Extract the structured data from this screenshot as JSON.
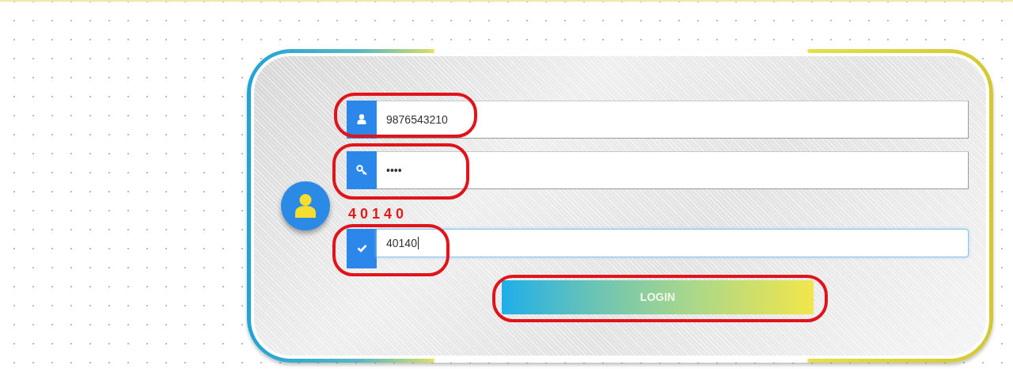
{
  "form": [
    {
      "kind": "username",
      "value": "9876543210",
      "focused": false
    },
    {
      "kind": "password",
      "value": "••••",
      "focused": false
    },
    {
      "kind": "code",
      "text": "40140"
    },
    {
      "kind": "captcha",
      "value": "40140",
      "focused": true
    }
  ],
  "login_button": {
    "label": "LOGIN"
  }
}
